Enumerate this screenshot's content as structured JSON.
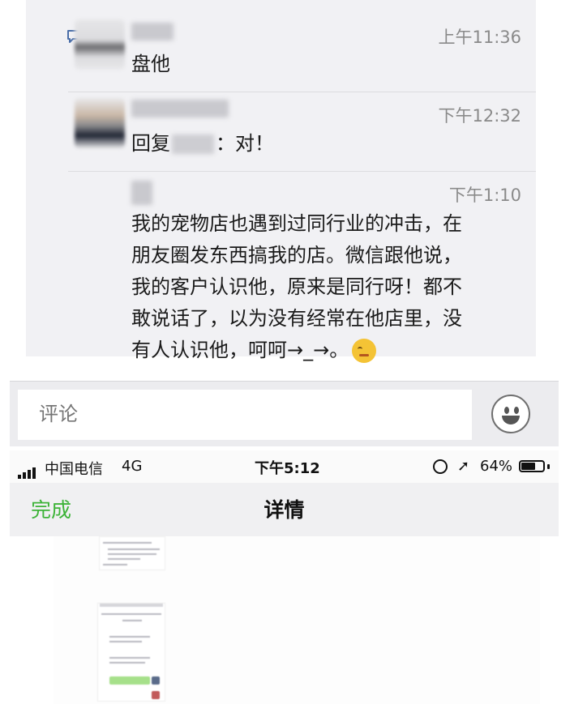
{
  "comments": [
    {
      "time": "上午11:36",
      "text": "盘他"
    },
    {
      "time": "下午12:32",
      "reply_prefix": "回复",
      "reply_suffix": "：对！"
    },
    {
      "time": "下午1:10",
      "text": "我的宠物店也遇到过同行业的冲击，在\n朋友圈发东西搞我的店。微信跟他说，\n我的客户认识他，原来是同行呀！都不\n敢说话了，以为没有经常在他店里，没\n有人认识他，呵呵→_→。"
    }
  ],
  "comment_input": {
    "placeholder": "评论"
  },
  "icons": {
    "comment": "comment-icon",
    "emoji": "smiley-emoji-icon",
    "smile_button": "smiley-face-icon",
    "signal": "signal-icon",
    "lock": "rotation-lock-icon",
    "location": "location-arrow-icon",
    "battery": "battery-icon"
  },
  "status_bar": {
    "carrier": "中国电信",
    "network": "4G",
    "time": "下午5:12",
    "battery_percent": "64%",
    "battery_level": 0.64
  },
  "nav": {
    "done_label": "完成",
    "title": "详情"
  },
  "colors": {
    "accent_green": "#3db338",
    "panel_bg": "#f1f1f4",
    "time_gray": "#8a8a8a"
  }
}
